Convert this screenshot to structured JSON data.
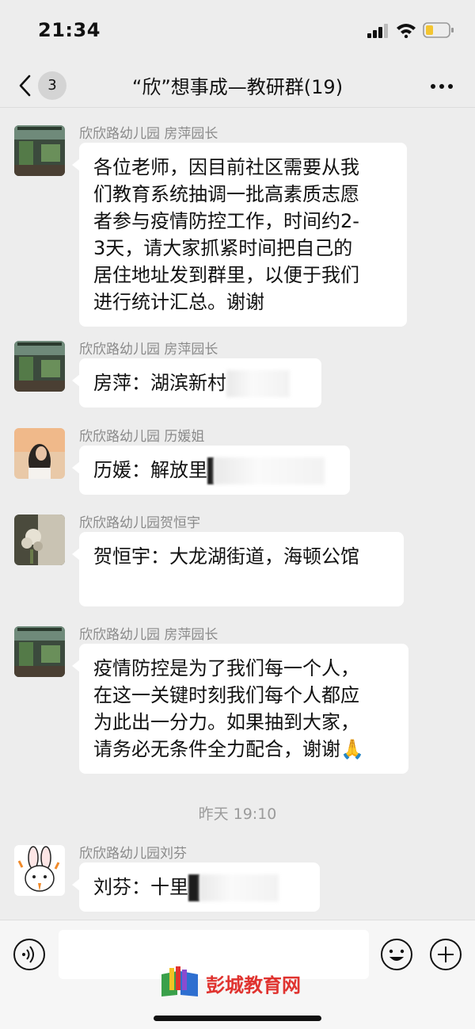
{
  "status_bar": {
    "time": "21:34"
  },
  "header": {
    "unread_count": "3",
    "title": "“欣”想事成—教研群(19)"
  },
  "messages": [
    {
      "sender": "欣欣路幼儿园 房萍园长",
      "text": "各位老师，因目前社区需要从我\n们教育系统抽调一批高素质志愿\n者参与疫情防控工作，时间约2-\n3天，请大家抓紧时间把自己的\n居住地址发到群里，以便于我们\n进行统计汇总。谢谢"
    },
    {
      "sender": "欣欣路幼儿园 房萍园长",
      "text": "房萍：湖滨新村"
    },
    {
      "sender": "欣欣路幼儿园 历媛姐",
      "text": "历媛：解放里"
    },
    {
      "sender": "欣欣路幼儿园贺恒宇",
      "text": "贺恒宇：大龙湖街道，海顿公馆"
    },
    {
      "sender": "欣欣路幼儿园 房萍园长",
      "text": "疫情防控是为了我们每一个人，\n在这一关键时刻我们每个人都应\n为此出一分力。如果抽到大家，\n请务必无条件全力配合，谢谢",
      "emoji": "🙏"
    },
    {
      "sender": "欣欣路幼儿园刘芬",
      "text": "刘芬：十里"
    }
  ],
  "time_divider": "昨天 19:10",
  "watermark": "彭城教育网",
  "icons": {
    "back": "chevron-left-icon",
    "more": "more-dots-icon",
    "voice": "voice-icon",
    "emoji": "emoji-icon",
    "plus": "plus-icon"
  },
  "colors": {
    "background": "#ededed",
    "bubble": "#ffffff",
    "sender": "#8a8a8a",
    "watermark": "#e0332f"
  }
}
